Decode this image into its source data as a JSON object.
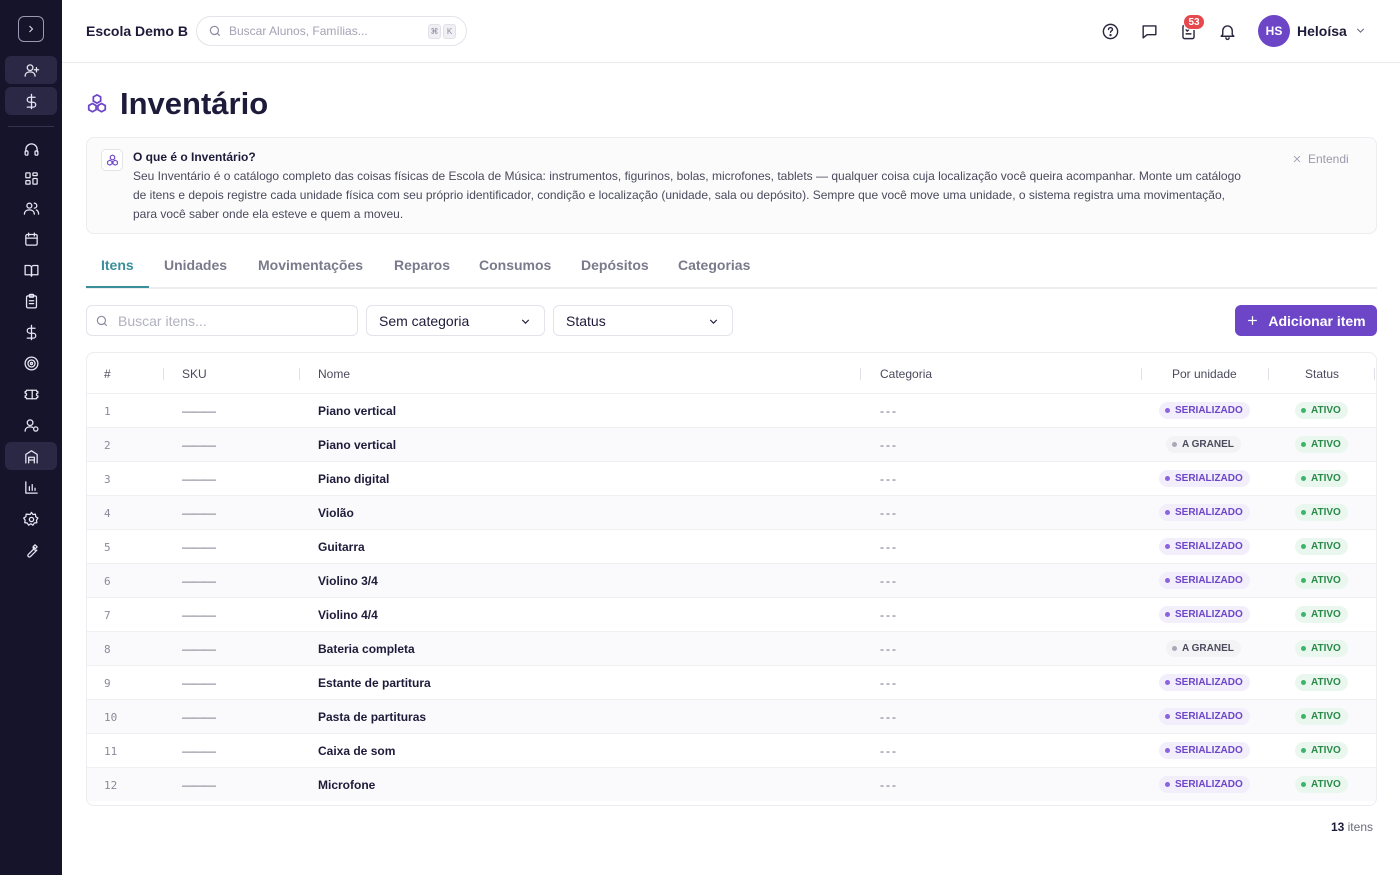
{
  "header": {
    "school_name": "Escola Demo B",
    "search_placeholder": "Buscar Alunos, Famílias...",
    "shortcut_keys": [
      "⌘",
      "K"
    ],
    "notification_count": "53",
    "user_initials": "HS",
    "user_name": "Heloísa"
  },
  "page": {
    "title": "Inventário"
  },
  "info": {
    "title": "O que é o Inventário?",
    "text": "Seu Inventário é o catálogo completo das coisas físicas de Escola de Música: instrumentos, figurinos, bolas, microfones, tablets — qualquer coisa cuja localização você queira acompanhar. Monte um catálogo de itens e depois registre cada unidade física com seu próprio identificador, condição e localização (unidade, sala ou depósito). Sempre que você move uma unidade, o sistema registra uma movimentação, para você saber onde ela esteve e quem a moveu.",
    "dismiss_label": "Entendi"
  },
  "tabs": [
    {
      "label": "Itens",
      "active": true
    },
    {
      "label": "Unidades",
      "active": false
    },
    {
      "label": "Movimentações",
      "active": false
    },
    {
      "label": "Reparos",
      "active": false
    },
    {
      "label": "Consumos",
      "active": false
    },
    {
      "label": "Depósitos",
      "active": false
    },
    {
      "label": "Categorias",
      "active": false
    }
  ],
  "filters": {
    "search_placeholder": "Buscar itens...",
    "category_value": "Sem categoria",
    "status_value": "Status",
    "add_label": "Adicionar item"
  },
  "table": {
    "columns": [
      "#",
      "SKU",
      "Nome",
      "Categoria",
      "Por unidade",
      "Status"
    ],
    "rows": [
      {
        "num": "1",
        "sku": "———",
        "name": "Piano vertical",
        "category": "---",
        "unit_type": "SERIALIZADO",
        "status": "ATIVO"
      },
      {
        "num": "2",
        "sku": "———",
        "name": "Piano vertical",
        "category": "---",
        "unit_type": "A GRANEL",
        "status": "ATIVO"
      },
      {
        "num": "3",
        "sku": "———",
        "name": "Piano digital",
        "category": "---",
        "unit_type": "SERIALIZADO",
        "status": "ATIVO"
      },
      {
        "num": "4",
        "sku": "———",
        "name": "Violão",
        "category": "---",
        "unit_type": "SERIALIZADO",
        "status": "ATIVO"
      },
      {
        "num": "5",
        "sku": "———",
        "name": "Guitarra",
        "category": "---",
        "unit_type": "SERIALIZADO",
        "status": "ATIVO"
      },
      {
        "num": "6",
        "sku": "———",
        "name": "Violino 3/4",
        "category": "---",
        "unit_type": "SERIALIZADO",
        "status": "ATIVO"
      },
      {
        "num": "7",
        "sku": "———",
        "name": "Violino 4/4",
        "category": "---",
        "unit_type": "SERIALIZADO",
        "status": "ATIVO"
      },
      {
        "num": "8",
        "sku": "———",
        "name": "Bateria completa",
        "category": "---",
        "unit_type": "A GRANEL",
        "status": "ATIVO"
      },
      {
        "num": "9",
        "sku": "———",
        "name": "Estante de partitura",
        "category": "---",
        "unit_type": "SERIALIZADO",
        "status": "ATIVO"
      },
      {
        "num": "10",
        "sku": "———",
        "name": "Pasta de partituras",
        "category": "---",
        "unit_type": "SERIALIZADO",
        "status": "ATIVO"
      },
      {
        "num": "11",
        "sku": "———",
        "name": "Caixa de som",
        "category": "---",
        "unit_type": "SERIALIZADO",
        "status": "ATIVO"
      },
      {
        "num": "12",
        "sku": "———",
        "name": "Microfone",
        "category": "---",
        "unit_type": "SERIALIZADO",
        "status": "ATIVO"
      }
    ]
  },
  "footer": {
    "count": "13",
    "count_label": "itens"
  },
  "colors": {
    "sidebar_bg": "#16142b",
    "accent_purple": "#6d46c8",
    "tab_active": "#3b8f9a",
    "badge_red": "#e5484d",
    "status_green": "#2a8a4a"
  },
  "icons": {
    "sidebar": [
      "chevron-right-icon",
      "user-plus-icon",
      "dollar-icon",
      "headset-icon",
      "dashboard-icon",
      "users-icon",
      "calendar-icon",
      "book-icon",
      "clipboard-icon",
      "dollar-icon",
      "target-icon",
      "ticket-icon",
      "user-settings-icon",
      "inventory-icon",
      "bar-chart-icon",
      "gear-icon",
      "wrench-icon"
    ],
    "header": [
      "help-icon",
      "message-icon",
      "tasks-icon",
      "bell-icon"
    ]
  }
}
